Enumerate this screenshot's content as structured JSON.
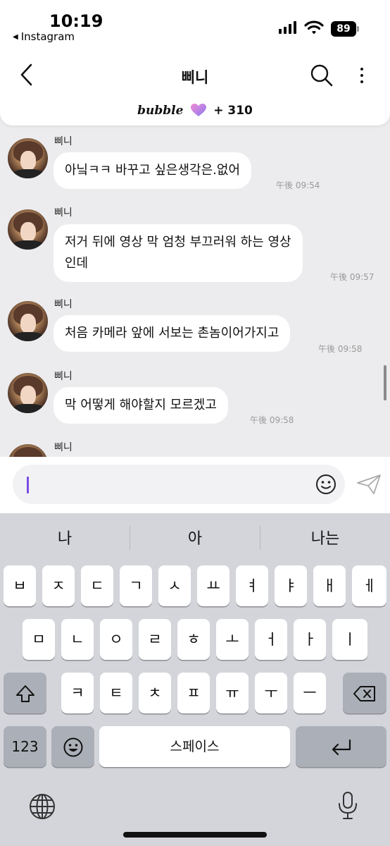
{
  "status_bar": {
    "time": "10:19",
    "back_app": "Instagram",
    "battery": "89"
  },
  "header": {
    "title": "삐니",
    "subscription": {
      "brand": "bubble",
      "extra": "+ 310"
    }
  },
  "messages": [
    {
      "sender": "삐니",
      "text": "아닠ㅋㅋ 바꾸고 싶은생각은.없어",
      "time": "午後 09:54"
    },
    {
      "sender": "삐니",
      "text": "저거 뒤에 영상 막 엄청 부끄러워 하는 영상\n인데",
      "time": "午後 09:57"
    },
    {
      "sender": "삐니",
      "text": "처음 카메라 앞에 서보는 촌놈이어가지고",
      "time": "午後 09:58"
    },
    {
      "sender": "삐니",
      "text": "막 어떻게 해야할지 모르겠고",
      "time": "午後 09:58"
    },
    {
      "sender": "삐니",
      "text": "",
      "time": ""
    }
  ],
  "input": {
    "value": "",
    "placeholder": ""
  },
  "keyboard": {
    "suggestions": [
      "나",
      "아",
      "나는"
    ],
    "row1": [
      "ㅂ",
      "ㅈ",
      "ㄷ",
      "ㄱ",
      "ㅅ",
      "ㅛ",
      "ㅕ",
      "ㅑ",
      "ㅐ",
      "ㅔ"
    ],
    "row2": [
      "ㅁ",
      "ㄴ",
      "ㅇ",
      "ㄹ",
      "ㅎ",
      "ㅗ",
      "ㅓ",
      "ㅏ",
      "ㅣ"
    ],
    "row3": [
      "ㅋ",
      "ㅌ",
      "ㅊ",
      "ㅍ",
      "ㅠ",
      "ㅜ",
      "ㅡ"
    ],
    "numbers_label": "123",
    "space_label": "스페이스"
  },
  "icons": {
    "back": "chevron-left-icon",
    "search": "search-icon",
    "more": "more-vertical-icon",
    "heart": "heart-icon",
    "emoji": "smiley-icon",
    "send": "send-icon",
    "shift": "shift-icon",
    "backspace": "backspace-icon",
    "emoji_key": "emoji-keyboard-icon",
    "return": "return-icon",
    "globe": "globe-icon",
    "mic": "microphone-icon"
  },
  "colors": {
    "accent": "#7b4de2",
    "chat_bg": "#ececee",
    "keyboard_bg": "#d3d5db"
  }
}
